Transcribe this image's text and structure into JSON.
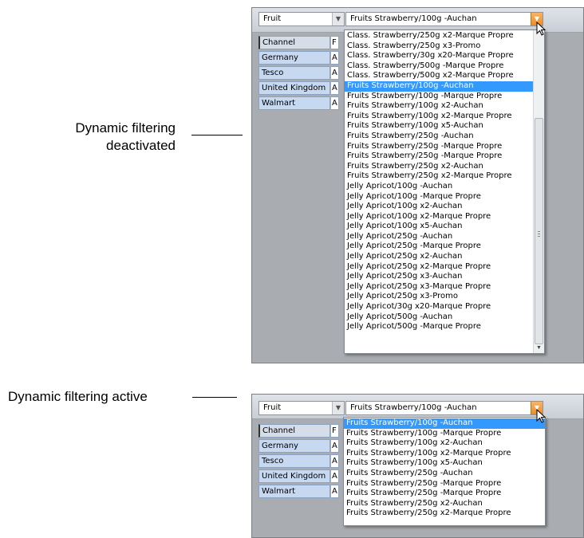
{
  "captions": {
    "top": [
      "Dynamic filtering",
      "deactivated"
    ],
    "bottom": "Dynamic filtering active"
  },
  "panel_top": {
    "dimension_combo": "Fruit",
    "product_combo": "Fruits Strawberry/100g -Auchan",
    "table": [
      {
        "label": "Channel",
        "value": "F"
      },
      {
        "label": "Germany",
        "value": "A"
      },
      {
        "label": "Tesco",
        "value": "A"
      },
      {
        "label": "United Kingdom",
        "value": "A"
      },
      {
        "label": "Walmart",
        "value": "A"
      }
    ],
    "list_items": [
      "Class.  Strawberry/250g x2-Marque Propre",
      "Class.  Strawberry/250g x3-Promo",
      "Class.  Strawberry/30g x20-Marque Propre",
      "Class.  Strawberry/500g -Marque Propre",
      "Class.  Strawberry/500g x2-Marque Propre",
      "Fruits Strawberry/100g -Auchan",
      "Fruits Strawberry/100g -Marque Propre",
      "Fruits Strawberry/100g x2-Auchan",
      "Fruits Strawberry/100g x2-Marque Propre",
      "Fruits Strawberry/100g x5-Auchan",
      "Fruits Strawberry/250g -Auchan",
      "Fruits Strawberry/250g -Marque Propre",
      "Fruits Strawberry/250g -Marque Propre",
      "Fruits Strawberry/250g x2-Auchan",
      "Fruits Strawberry/250g x2-Marque Propre",
      "Jelly Apricot/100g -Auchan",
      "Jelly Apricot/100g -Marque Propre",
      "Jelly Apricot/100g x2-Auchan",
      "Jelly Apricot/100g x2-Marque Propre",
      "Jelly Apricot/100g x5-Auchan",
      "Jelly Apricot/250g -Auchan",
      "Jelly Apricot/250g -Marque Propre",
      "Jelly Apricot/250g x2-Auchan",
      "Jelly Apricot/250g x2-Marque Propre",
      "Jelly Apricot/250g x3-Auchan",
      "Jelly Apricot/250g x3-Marque Propre",
      "Jelly Apricot/250g x3-Promo",
      "Jelly Apricot/30g x20-Marque Propre",
      "Jelly Apricot/500g -Auchan",
      "Jelly Apricot/500g -Marque Propre"
    ],
    "selected_index": 5
  },
  "panel_bottom": {
    "dimension_combo": "Fruit",
    "product_combo": "Fruits Strawberry/100g -Auchan",
    "table": [
      {
        "label": "Channel",
        "value": "F"
      },
      {
        "label": "Germany",
        "value": "A"
      },
      {
        "label": "Tesco",
        "value": "A"
      },
      {
        "label": "United Kingdom",
        "value": "A"
      },
      {
        "label": "Walmart",
        "value": "A"
      }
    ],
    "list_items": [
      "Fruits Strawberry/100g -Auchan",
      "Fruits Strawberry/100g -Marque Propre",
      "Fruits Strawberry/100g x2-Auchan",
      "Fruits Strawberry/100g x2-Marque Propre",
      "Fruits Strawberry/100g x5-Auchan",
      "Fruits Strawberry/250g -Auchan",
      "Fruits Strawberry/250g -Marque Propre",
      "Fruits Strawberry/250g -Marque Propre",
      "Fruits Strawberry/250g x2-Auchan",
      "Fruits Strawberry/250g x2-Marque Propre"
    ],
    "selected_index": 0
  },
  "icons": {
    "dropdown_arrow": "chevron-down-icon",
    "cursor": "mouse-pointer-icon",
    "scroll_up": "scroll-up-icon",
    "scroll_down": "scroll-down-icon",
    "scroll_grip": "scroll-grip-icon"
  },
  "colors": {
    "selection": "#3399ff",
    "dropdown_button_active": "#ed8b22",
    "table_label_bg": "#c6d9f0",
    "panel_bg": "#a9acb1"
  }
}
